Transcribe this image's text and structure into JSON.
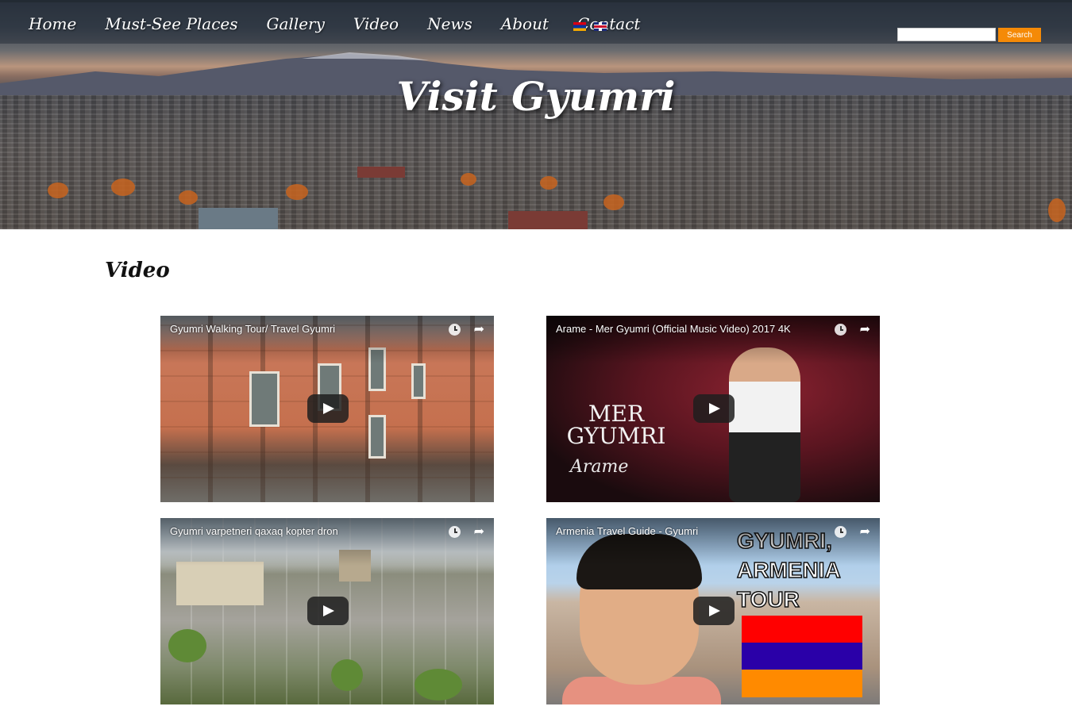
{
  "nav": {
    "items": [
      "Home",
      "Must-See Places",
      "Gallery",
      "Video",
      "News",
      "About",
      "Contact"
    ],
    "languages": [
      "Armenian",
      "English"
    ]
  },
  "search": {
    "value": "",
    "button_label": "Search"
  },
  "hero": {
    "title": "Visit Gyumri"
  },
  "page": {
    "section_title": "Video"
  },
  "videos": [
    {
      "title": "Gyumri Walking Tour/ Travel Gyumri"
    },
    {
      "title": "Arame - Mer Gyumri (Official Music Video) 2017 4K",
      "overlay_text_1": "MER",
      "overlay_text_2": "GYUMRI",
      "overlay_signature": "Arame"
    },
    {
      "title": "Gyumri varpetneri qaxaq kopter dron"
    },
    {
      "title": "Armenia Travel Guide - Gyumri",
      "overlay_text": "GYUMRI, ARMENIA TOUR"
    }
  ],
  "colors": {
    "accent": "#f58a07",
    "nav_text": "#ffffff"
  },
  "icons": {
    "video_controls": [
      "clock-icon",
      "share-icon",
      "play-icon"
    ]
  }
}
